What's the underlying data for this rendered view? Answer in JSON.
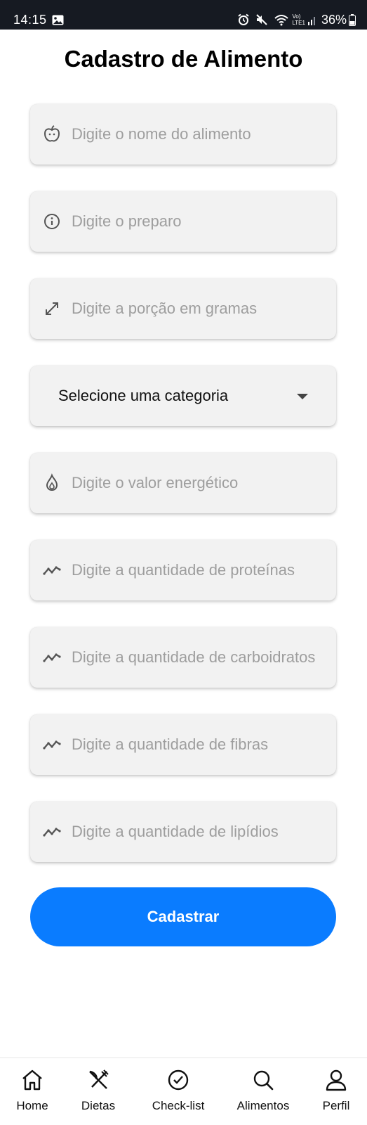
{
  "status_bar": {
    "time": "14:15",
    "battery": "36%",
    "network_label_top": "Vo)",
    "network_label_bottom": "LTE1"
  },
  "page": {
    "title": "Cadastro de Alimento"
  },
  "form": {
    "fields": [
      {
        "icon": "apple-icon",
        "placeholder": "Digite o nome do alimento",
        "value": ""
      },
      {
        "icon": "info-icon",
        "placeholder": "Digite o preparo",
        "value": ""
      },
      {
        "icon": "expand-arrows-icon",
        "placeholder": "Digite a porção em gramas",
        "value": ""
      },
      {
        "icon": "flame-icon",
        "placeholder": "Digite o valor energético",
        "value": ""
      },
      {
        "icon": "trend-line-icon",
        "placeholder": "Digite a quantidade de proteínas",
        "value": ""
      },
      {
        "icon": "trend-line-icon",
        "placeholder": "Digite a quantidade de carboidratos",
        "value": ""
      },
      {
        "icon": "trend-line-icon",
        "placeholder": "Digite a quantidade de fibras",
        "value": ""
      },
      {
        "icon": "trend-line-icon",
        "placeholder": "Digite a quantidade de lipídios",
        "value": ""
      }
    ],
    "category_select": {
      "selected": "Selecione uma categoria",
      "icon": "dropdown-arrow-icon"
    },
    "submit_label": "Cadastrar"
  },
  "bottom_nav": {
    "items": [
      {
        "label": "Home",
        "icon": "home-icon"
      },
      {
        "label": "Dietas",
        "icon": "utensils-icon"
      },
      {
        "label": "Check-list",
        "icon": "check-circle-icon"
      },
      {
        "label": "Alimentos",
        "icon": "search-icon"
      },
      {
        "label": "Perfil",
        "icon": "user-icon"
      }
    ]
  },
  "colors": {
    "accent": "#0a7cff",
    "field_background": "#f2f2f2",
    "placeholder": "#9e9e9e",
    "status_bar": "#161a22"
  }
}
